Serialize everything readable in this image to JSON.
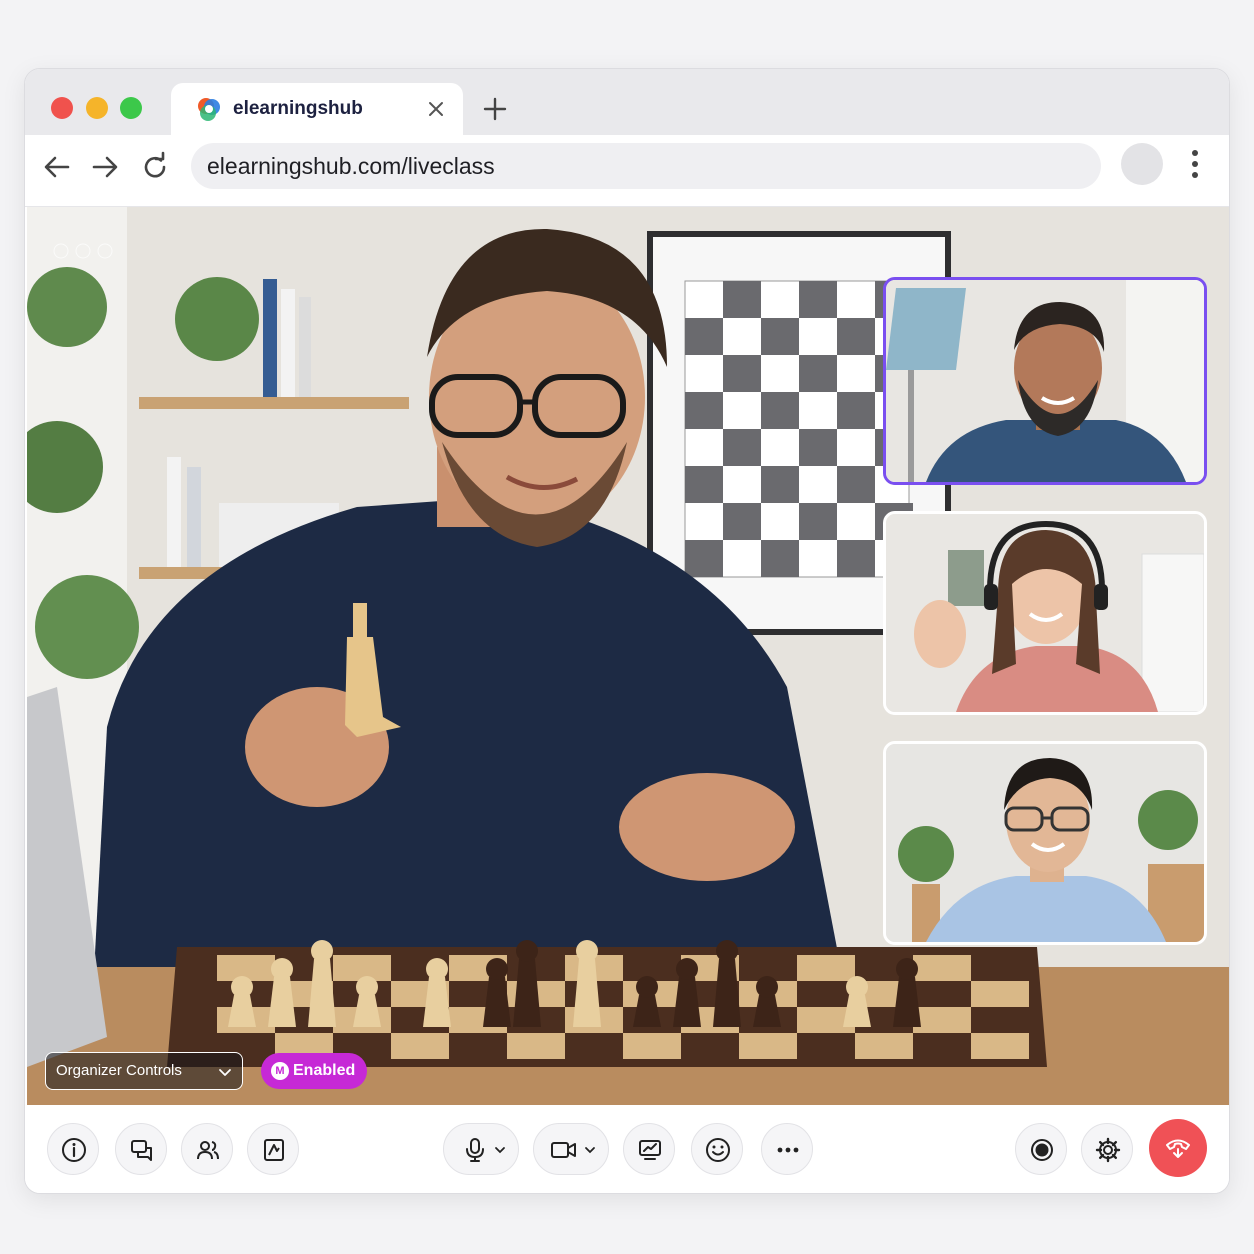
{
  "browser": {
    "tab_title": "elearningshub",
    "url": "elearningshub.com/liveclass",
    "icons": {
      "close": "close-icon",
      "new_tab": "plus-icon",
      "back": "back-arrow-icon",
      "forward": "forward-arrow-icon",
      "reload": "reload-icon",
      "menu": "kebab-menu-icon"
    }
  },
  "meeting": {
    "organizer_controls_label": "Organizer Controls",
    "enabled_badge": "Enabled",
    "enabled_badge_icon_letter": "M",
    "active_tile_color": "#7a4ff0",
    "end_call_color": "#f05156",
    "enabled_badge_color": "#c629d6"
  },
  "controls": {
    "left": [
      "info-icon",
      "chat-icon",
      "participants-icon",
      "whiteboard-icon"
    ],
    "center": [
      "microphone-icon",
      "camera-icon",
      "share-screen-icon",
      "emoji-icon",
      "more-icon"
    ],
    "right": [
      "record-icon",
      "settings-icon",
      "end-call-icon"
    ]
  }
}
